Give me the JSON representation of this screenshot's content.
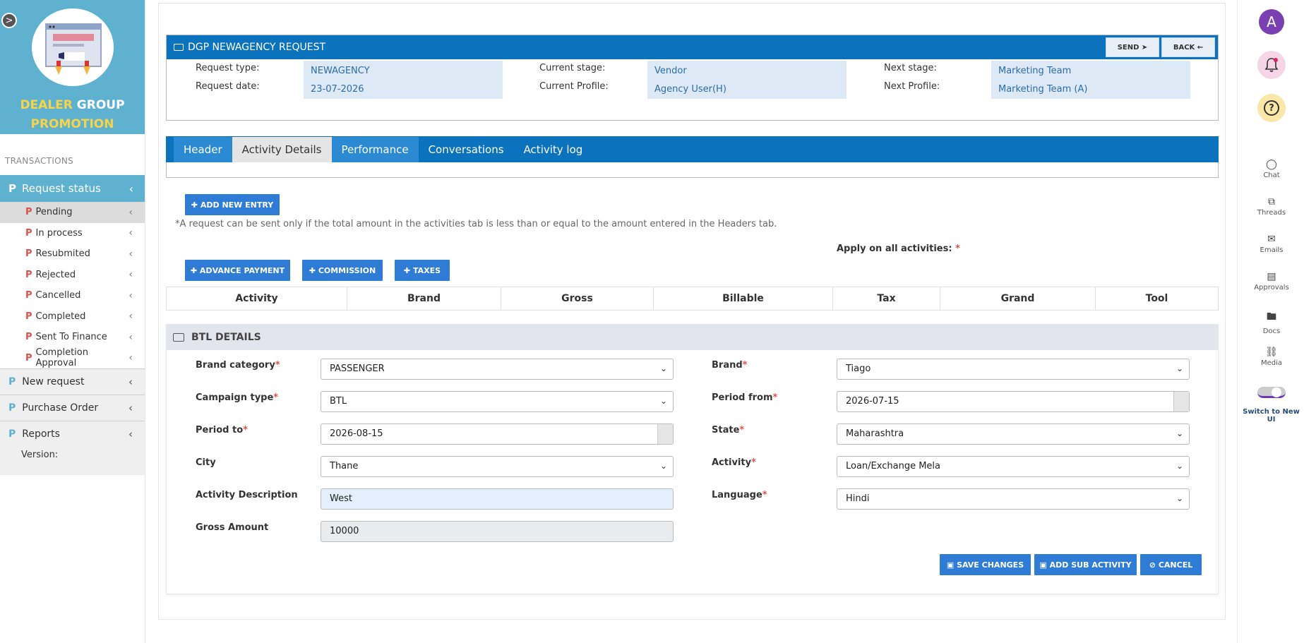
{
  "brand": {
    "line1_yellow": "DEALER",
    "line1_white": "GROUP",
    "line2": "PROMOTION",
    "toggle_glyph": ">"
  },
  "sidebar": {
    "section": "TRANSACTIONS",
    "request_status": "Request status",
    "items": [
      "Pending",
      "In process",
      "Resubmited",
      "Rejected",
      "Cancelled",
      "Completed",
      "Sent To Finance",
      "Completion Approval"
    ],
    "new_request": "New request",
    "purchase_order": "Purchase Order",
    "reports": "Reports",
    "version": "Version:"
  },
  "request": {
    "title": "DGP NEWAGENCY REQUEST",
    "send": "SEND",
    "back": "BACK",
    "request_type_label": "Request type:",
    "request_type": "NEWAGENCY",
    "request_date_label": "Request date:",
    "request_date": "23-07-2026",
    "current_stage_label": "Current stage:",
    "current_stage": "Vendor",
    "current_profile_label": "Current Profile:",
    "current_profile": "Agency User(H)",
    "next_stage_label": "Next stage:",
    "next_stage": "Marketing Team",
    "next_profile_label": "Next Profile:",
    "next_profile": "Marketing Team (A)"
  },
  "tabs": [
    "Header",
    "Activity Details",
    "Performance",
    "Conversations",
    "Activity log"
  ],
  "actions": {
    "add_new_entry": "ADD NEW ENTRY",
    "note": "*A request can be sent only if the total amount in the activities tab is less than or equal to the amount entered in the Headers tab.",
    "apply_all": "Apply on all activities:",
    "advance_payment": "ADVANCE PAYMENT",
    "commission": "COMMISSION",
    "taxes": "TAXES"
  },
  "table": {
    "headers": [
      "Activity",
      "Brand",
      "Gross",
      "Billable",
      "Tax",
      "Grand",
      "Tool"
    ]
  },
  "btl": {
    "title": "BTL DETAILS",
    "brand_category_label": "Brand category",
    "brand_category": "PASSENGER",
    "brand_label": "Brand",
    "brand": "Tiago",
    "campaign_type_label": "Campaign type",
    "campaign_type": "BTL",
    "period_from_label": "Period from",
    "period_from": "2026-07-15",
    "period_to_label": "Period to",
    "period_to": "2026-08-15",
    "state_label": "State",
    "state": "Maharashtra",
    "city_label": "City",
    "city": "Thane",
    "activity_label": "Activity",
    "activity": "Loan/Exchange Mela",
    "activity_desc_label": "Activity Description",
    "activity_desc": "West",
    "language_label": "Language",
    "language": "Hindi",
    "gross_amount_label": "Gross Amount",
    "gross_amount": "10000",
    "save_changes": "SAVE CHANGES",
    "add_sub_activity": "ADD SUB ACTIVITY",
    "cancel": "CANCEL"
  },
  "rail": {
    "avatar": "A",
    "help": "?",
    "chat": "Chat",
    "threads": "Threads",
    "emails": "Emails",
    "approvals": "Approvals",
    "docs": "Docs",
    "media": "Media",
    "switch": "Switch to New UI"
  },
  "colors": {
    "primary": "#0b72bd",
    "sidebar": "#5fb2cf",
    "button": "#2e7cd6",
    "accent": "#f7d447"
  }
}
